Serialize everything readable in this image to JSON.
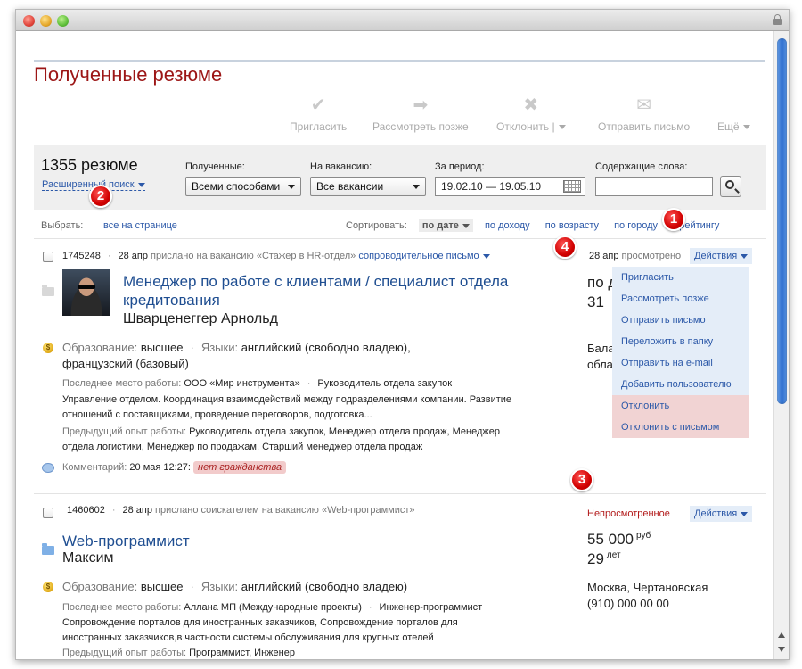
{
  "page": {
    "title": "Полученные резюме"
  },
  "toolbar": {
    "invite": "Пригласить",
    "later": "Рассмотреть позже",
    "reject": "Отклонить",
    "reject_sep": "|",
    "send": "Отправить письмо",
    "more": "Ещё"
  },
  "filters": {
    "count": "1355 резюме",
    "advanced": "Расширенный поиск",
    "received_label": "Полученные:",
    "received_value": "Всеми способами",
    "vacancy_label": "На вакансию:",
    "vacancy_value": "Все вакансии",
    "period_label": "За период:",
    "period_value": "19.02.10 — 19.05.10",
    "words_label": "Содержащие слова:"
  },
  "select": {
    "label": "Выбрать:",
    "all": "все на странице"
  },
  "sort": {
    "label": "Сортировать:",
    "date": "по дате",
    "income": "по доходу",
    "age": "по возрасту",
    "city": "по городу",
    "rating": "по рейтингу"
  },
  "resume1": {
    "id": "1745248",
    "date": "28 апр",
    "sent": "прислано на вакансию «Стажер в HR-отдел»",
    "cover": "сопроводительное письмо",
    "view_date": "28 апр",
    "viewed": "просмотрено",
    "actions": "Действия",
    "title_l1": "Менеджер по работе с клиентами / специалист отдела",
    "title_l2": "кредитования",
    "name": "Шварценеггер Арнольд",
    "edu_k": "Образование:",
    "edu_v": "высшее",
    "lang_k": "Языки:",
    "lang_v1": "английский (свободно владею),",
    "lang_v2": "французский (базовый)",
    "last_k": "Последнее место работы:",
    "last_co": "ООО «Мир инструмента»",
    "last_pos": "Руководитель отдела закупок",
    "duties_l1": "Управление отделом. Координация взаимодействий между подразделениями компании. Развитие",
    "duties_l2": "отношений с поставщиками, проведение переговоров, подготовка...",
    "prev_k": "Предыдущий опыт работы:",
    "prev_v1": "Руководитель отдела закупок, Менеджер отдела продаж, Менеджер",
    "prev_v2": "отдела логистики, Менеджер по продажам, Старший менеджер отдела продаж",
    "comment_k": "Комментарий:",
    "comment_date": "20 мая 12:27:",
    "comment_tag": "нет гражданства",
    "right_a": "по д",
    "right_b": "31",
    "right_c": "Бала",
    "right_d": "обла"
  },
  "menu": {
    "items": [
      "Пригласить",
      "Рассмотреть позже",
      "Отправить письмо",
      "Переложить в папку",
      "Отправить на e-mail",
      "Добавить пользователю",
      "Отклонить",
      "Отклонить с письмом"
    ]
  },
  "resume2": {
    "id": "1460602",
    "date": "28 апр",
    "sent": "прислано соискателем на вакансию «Web-программист»",
    "status": "Непросмотренное",
    "actions": "Действия",
    "title": "Web-программист",
    "name": "Максим",
    "edu_k": "Образование:",
    "edu_v": "высшее",
    "lang_k": "Языки:",
    "lang_v": "английский (свободно владею)",
    "last_k": "Последнее место работы:",
    "last_co": "Аллана МП (Международные проекты)",
    "last_pos": "Инженер-программист",
    "duties_l1": "Сопровождение порталов для иностранных заказчиков, Сопровождение порталов для",
    "duties_l2": "иностранных заказчиков,в частности системы обслуживания для крупных отелей",
    "prev_k": "Предыдущий опыт работы:",
    "prev_v": "Программист, Инженер",
    "salary": "55 000",
    "salary_unit": "руб",
    "age": "29",
    "age_unit": "лет",
    "city": "Москва, Чертановская",
    "phone": "(910) 000 00 00"
  },
  "badges": {
    "b1": "1",
    "b2": "2",
    "b3": "3",
    "b4": "4"
  }
}
